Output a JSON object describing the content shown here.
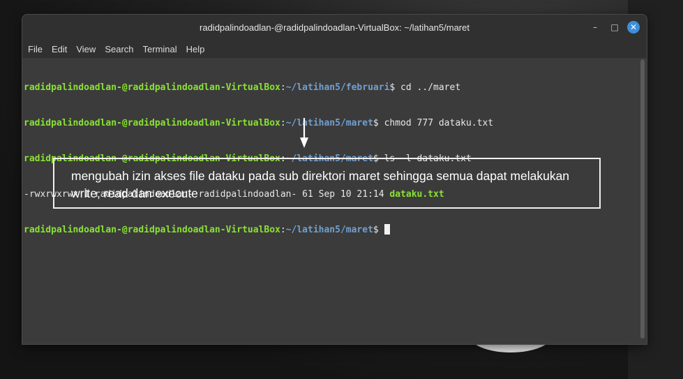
{
  "window": {
    "title": "radidpalindoadlan-@radidpalindoadlan-VirtualBox: ~/latihan5/maret",
    "controls": {
      "minimize": "–",
      "maximize": "□",
      "close": "✕"
    }
  },
  "menu": [
    "File",
    "Edit",
    "View",
    "Search",
    "Terminal",
    "Help"
  ],
  "terminal": {
    "user": "radidpalindoadlan-@radidpalindoadlan-VirtualBox",
    "lines": [
      {
        "path": "~/latihan5/februari",
        "cmd": " cd ../maret"
      },
      {
        "path": "~/latihan5/maret",
        "cmd": " chmod 777 dataku.txt"
      },
      {
        "path": "~/latihan5/maret",
        "cmd": " ls -l dataku.txt"
      }
    ],
    "ls_output": "-rwxrwxrwx 1 radidpalindoadlan- radidpalindoadlan- 61 Sep 10 21:14 ",
    "ls_file": "dataku.txt",
    "prompt_path": "~/latihan5/maret"
  },
  "annotation": {
    "text": "mengubah izin akses file dataku pada sub direktori maret sehingga semua dapat melakukan write, read dan execute"
  },
  "colors": {
    "user": "#8ae234",
    "path": "#729fcf",
    "close_button": "#3d8fd8"
  }
}
